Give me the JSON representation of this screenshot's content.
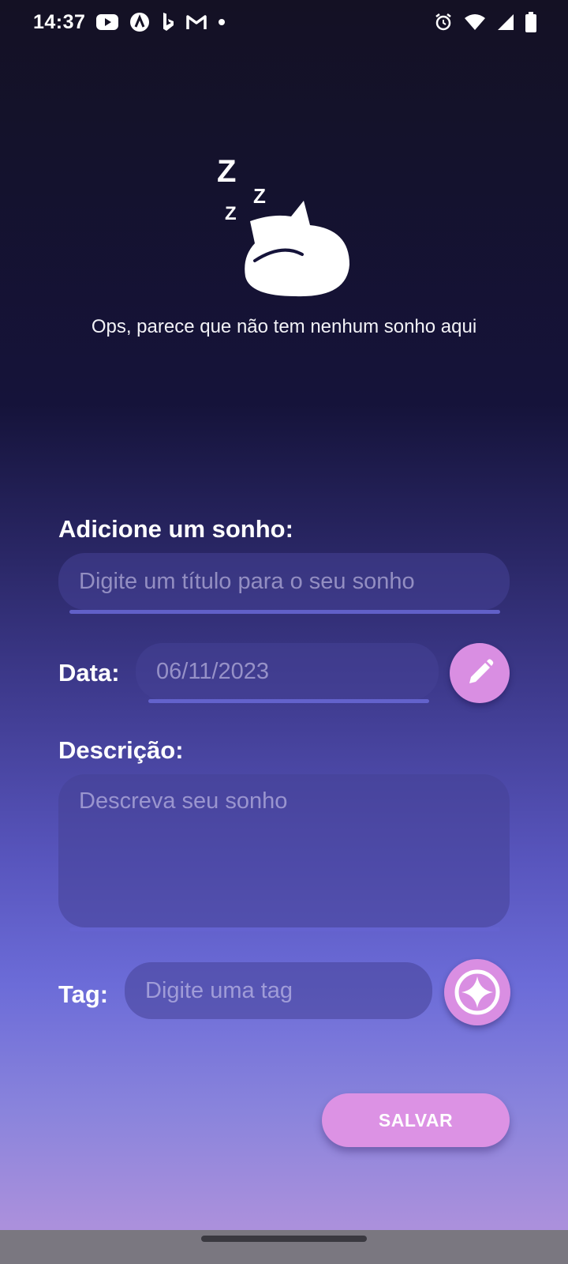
{
  "status_bar": {
    "time": "14:37",
    "left_icons": [
      "youtube-icon",
      "nebula-icon",
      "bing-icon",
      "gmail-icon",
      "dot-icon"
    ],
    "right_icons": [
      "alarm-icon",
      "wifi-icon",
      "signal-icon",
      "battery-icon"
    ]
  },
  "empty_state": {
    "illustration": "sleeping-cat-icon",
    "zz_text": "Z",
    "message": "Ops, parece que não tem nenhum sonho aqui"
  },
  "form": {
    "heading": "Adicione um sonho:",
    "title_placeholder": "Digite um título para o seu sonho",
    "date_label": "Data:",
    "date_value": "06/11/2023",
    "description_label": "Descrição:",
    "description_placeholder": "Descreva seu sonho",
    "tag_label": "Tag:",
    "tag_placeholder": "Digite uma tag",
    "save_label": "SALVAR"
  },
  "colors": {
    "accent": "#dc92e4",
    "field_underline": "#6a68d6"
  }
}
